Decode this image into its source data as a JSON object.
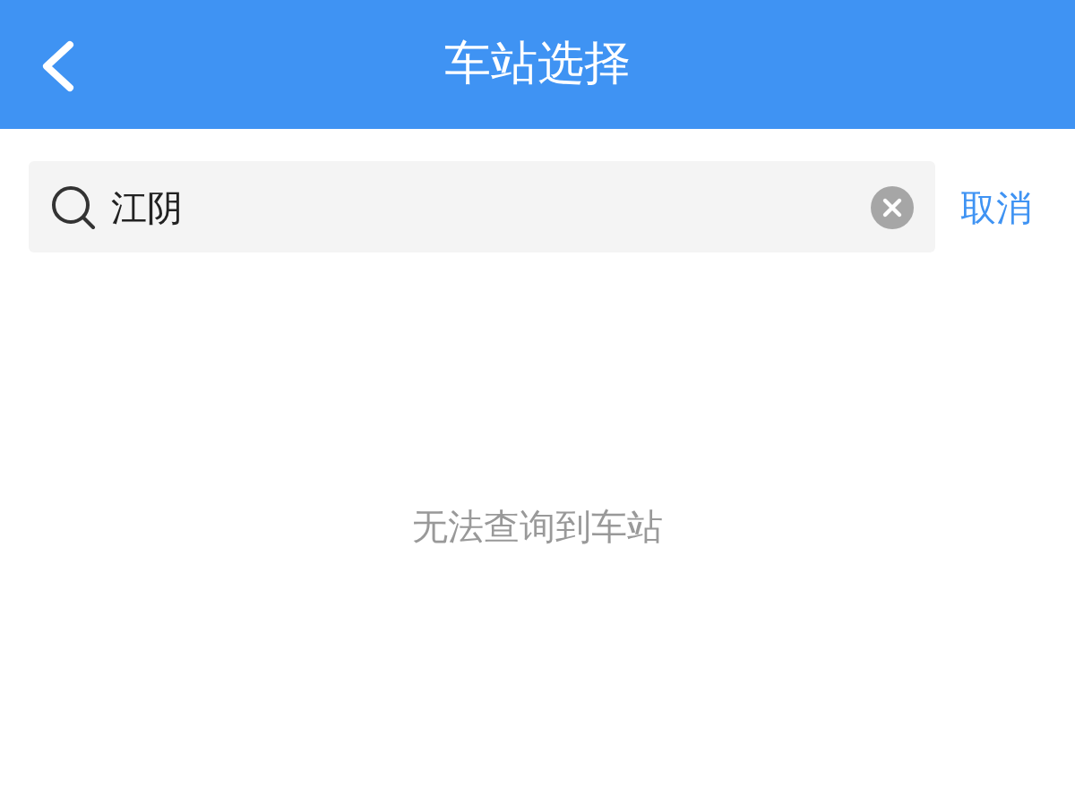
{
  "header": {
    "title": "车站选择"
  },
  "search": {
    "value": "江阴"
  },
  "cancel_button": {
    "label": "取消"
  },
  "empty_message": "无法查询到车站"
}
